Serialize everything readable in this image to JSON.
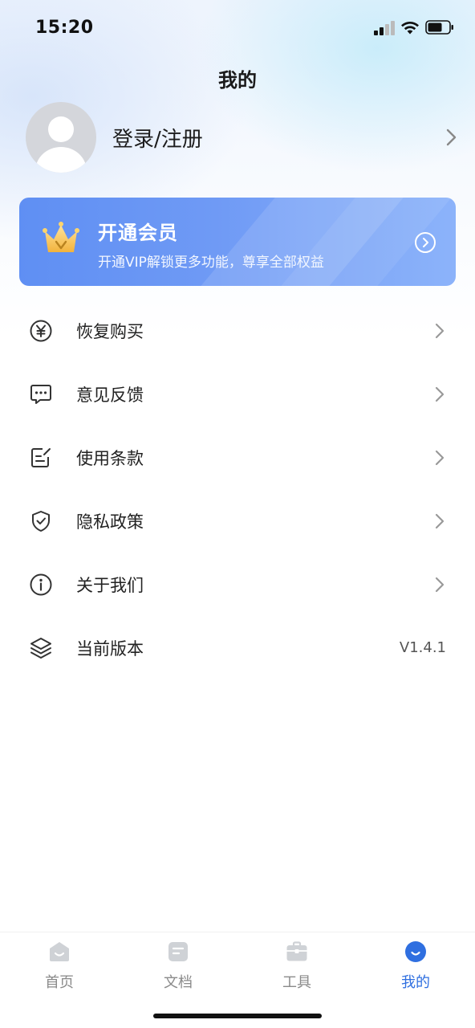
{
  "status_bar": {
    "time": "15:20",
    "icons": [
      "cellular-signal-icon",
      "wifi-icon",
      "battery-icon"
    ]
  },
  "header": {
    "title": "我的"
  },
  "profile": {
    "login_label": "登录/注册",
    "avatar_icon": "default-avatar-icon"
  },
  "vip": {
    "title": "开通会员",
    "subtitle": "开通VIP解锁更多功能，尊享全部权益",
    "icon": "crown-icon",
    "accent_color": "#5f8ff3"
  },
  "menu": {
    "items": [
      {
        "label": "恢复购买",
        "icon": "yen-icon"
      },
      {
        "label": "意见反馈",
        "icon": "chat-bubble-icon"
      },
      {
        "label": "使用条款",
        "icon": "edit-document-icon"
      },
      {
        "label": "隐私政策",
        "icon": "shield-check-icon"
      },
      {
        "label": "关于我们",
        "icon": "info-icon"
      },
      {
        "label": "当前版本",
        "icon": "layers-icon",
        "value": "V1.4.1"
      }
    ]
  },
  "tabbar": {
    "tabs": [
      {
        "label": "首页",
        "icon": "home-icon",
        "active": false
      },
      {
        "label": "文档",
        "icon": "document-icon",
        "active": false
      },
      {
        "label": "工具",
        "icon": "toolbox-icon",
        "active": false
      },
      {
        "label": "我的",
        "icon": "profile-smile-icon",
        "active": true
      }
    ],
    "active_color": "#2f6fe0",
    "inactive_color": "#8a8a8a"
  }
}
